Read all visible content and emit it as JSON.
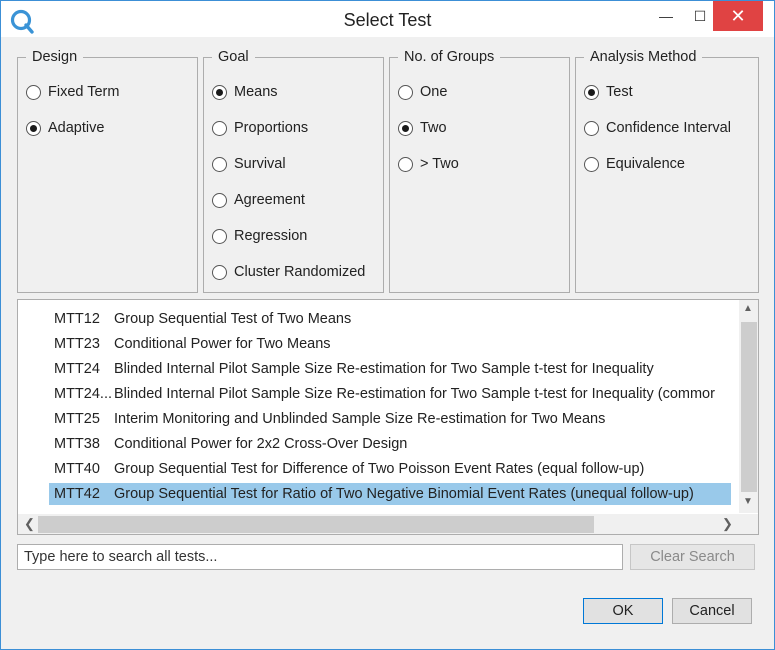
{
  "window": {
    "title": "Select Test",
    "minimize_glyph": "—",
    "maximize_glyph": "☐",
    "close_glyph": "✕",
    "accent_color": "#3c8fd6",
    "close_color": "#e04343",
    "selected_row_color": "#99c9ea"
  },
  "groups": {
    "design": {
      "title": "Design",
      "options": [
        {
          "label": "Fixed Term",
          "checked": false
        },
        {
          "label": "Adaptive",
          "checked": true
        }
      ]
    },
    "goal": {
      "title": "Goal",
      "options": [
        {
          "label": "Means",
          "checked": true
        },
        {
          "label": "Proportions",
          "checked": false
        },
        {
          "label": "Survival",
          "checked": false
        },
        {
          "label": "Agreement",
          "checked": false
        },
        {
          "label": "Regression",
          "checked": false
        },
        {
          "label": "Cluster Randomized",
          "checked": false
        }
      ]
    },
    "groups_count": {
      "title": "No. of Groups",
      "options": [
        {
          "label": "One",
          "checked": false
        },
        {
          "label": "Two",
          "checked": true
        },
        {
          "label": "> Two",
          "checked": false
        }
      ]
    },
    "analysis": {
      "title": "Analysis Method",
      "options": [
        {
          "label": "Test",
          "checked": true
        },
        {
          "label": "Confidence Interval",
          "checked": false
        },
        {
          "label": "Equivalence",
          "checked": false
        }
      ]
    }
  },
  "tests": [
    {
      "code": "MTT12",
      "name": "Group Sequential Test of Two Means",
      "selected": false
    },
    {
      "code": "MTT23",
      "name": "Conditional Power for Two Means",
      "selected": false
    },
    {
      "code": "MTT24",
      "name": "Blinded Internal Pilot Sample Size Re-estimation for Two Sample t-test for Inequality",
      "selected": false
    },
    {
      "code": "MTT24...",
      "name": "Blinded Internal Pilot Sample Size Re-estimation for Two Sample t-test for Inequality (commor",
      "selected": false
    },
    {
      "code": "MTT25",
      "name": "Interim Monitoring and Unblinded Sample Size Re-estimation for Two Means",
      "selected": false
    },
    {
      "code": "MTT38",
      "name": "Conditional Power for 2x2 Cross-Over Design",
      "selected": false
    },
    {
      "code": "MTT40",
      "name": "Group Sequential Test for Difference of Two Poisson Event Rates (equal follow-up)",
      "selected": false
    },
    {
      "code": "MTT42",
      "name": "Group Sequential Test for Ratio of Two Negative Binomial Event Rates (unequal follow-up)",
      "selected": true
    }
  ],
  "scroll": {
    "up": "▲",
    "down": "▼",
    "left": "❮",
    "right": "❯"
  },
  "search": {
    "placeholder": "Type here to search all tests...",
    "value": ""
  },
  "buttons": {
    "clear_search": "Clear Search",
    "ok": "OK",
    "cancel": "Cancel"
  }
}
